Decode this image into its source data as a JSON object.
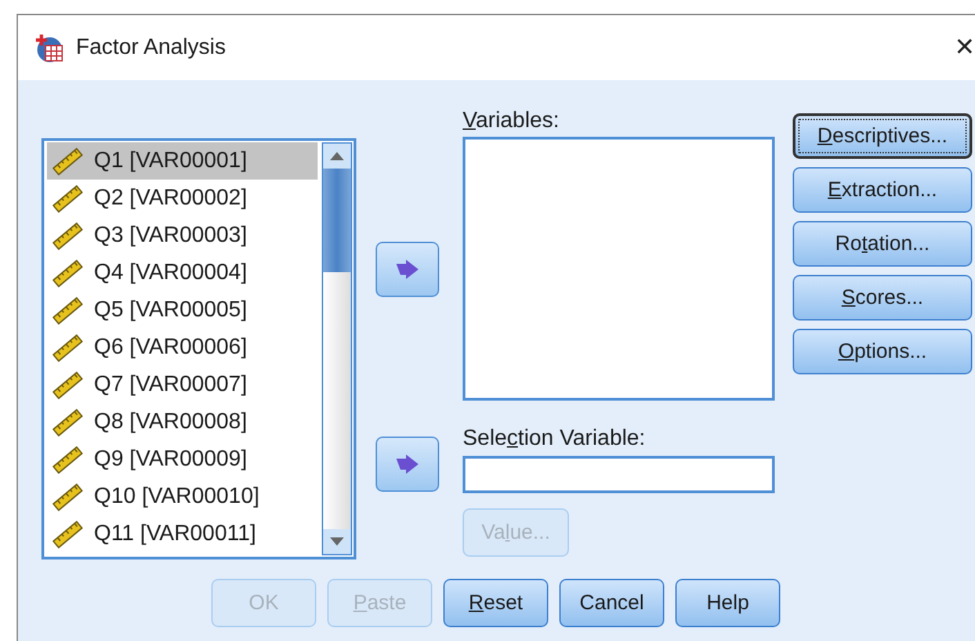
{
  "window": {
    "title": "Factor Analysis",
    "close": "✕"
  },
  "source_list": {
    "items": [
      {
        "label": "Q1 [VAR00001]",
        "selected": true
      },
      {
        "label": "Q2 [VAR00002]",
        "selected": false
      },
      {
        "label": "Q3 [VAR00003]",
        "selected": false
      },
      {
        "label": "Q4 [VAR00004]",
        "selected": false
      },
      {
        "label": "Q5 [VAR00005]",
        "selected": false
      },
      {
        "label": "Q6 [VAR00006]",
        "selected": false
      },
      {
        "label": "Q7 [VAR00007]",
        "selected": false
      },
      {
        "label": "Q8 [VAR00008]",
        "selected": false
      },
      {
        "label": "Q9 [VAR00009]",
        "selected": false
      },
      {
        "label": "Q10 [VAR00010]",
        "selected": false
      },
      {
        "label": "Q11 [VAR00011]",
        "selected": false
      }
    ]
  },
  "variables": {
    "label": [
      {
        "text": "V",
        "underlined": true
      },
      {
        "text": "ariables:",
        "underlined": false
      }
    ]
  },
  "selection_variable": {
    "label": [
      {
        "text": "Sele",
        "underlined": false
      },
      {
        "text": "c",
        "underlined": true
      },
      {
        "text": "tion Variable:",
        "underlined": false
      }
    ],
    "value_button": {
      "label": [
        {
          "text": "Va",
          "underlined": false
        },
        {
          "text": "l",
          "underlined": true
        },
        {
          "text": "ue...",
          "underlined": false
        }
      ],
      "disabled": true
    }
  },
  "side_buttons": [
    {
      "label": [
        {
          "text": "D",
          "underlined": true
        },
        {
          "text": "escriptives...",
          "underlined": false
        }
      ],
      "focused": true
    },
    {
      "label": [
        {
          "text": "E",
          "underlined": true
        },
        {
          "text": "xtraction...",
          "underlined": false
        }
      ],
      "focused": false
    },
    {
      "label": [
        {
          "text": "Ro",
          "underlined": false
        },
        {
          "text": "t",
          "underlined": true
        },
        {
          "text": "ation...",
          "underlined": false
        }
      ],
      "focused": false
    },
    {
      "label": [
        {
          "text": "S",
          "underlined": true
        },
        {
          "text": "cores...",
          "underlined": false
        }
      ],
      "focused": false
    },
    {
      "label": [
        {
          "text": "O",
          "underlined": true
        },
        {
          "text": "ptions...",
          "underlined": false
        }
      ],
      "focused": false
    }
  ],
  "bottom_buttons": [
    {
      "label": [
        {
          "text": "OK",
          "underlined": false
        }
      ],
      "disabled": true
    },
    {
      "label": [
        {
          "text": "P",
          "underlined": true
        },
        {
          "text": "aste",
          "underlined": false
        }
      ],
      "disabled": true
    },
    {
      "label": [
        {
          "text": "R",
          "underlined": true
        },
        {
          "text": "eset",
          "underlined": false
        }
      ],
      "disabled": false
    },
    {
      "label": [
        {
          "text": "Cancel",
          "underlined": false
        }
      ],
      "disabled": false
    },
    {
      "label": [
        {
          "text": "Help",
          "underlined": false
        }
      ],
      "disabled": false
    }
  ]
}
